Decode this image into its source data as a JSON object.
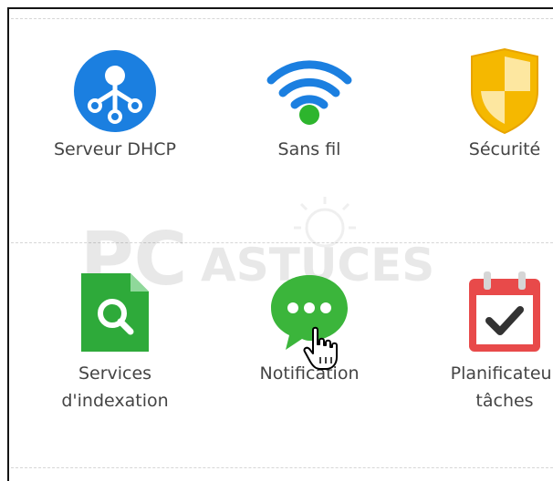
{
  "tiles": [
    {
      "label": "Serveur DHCP",
      "icon": "dhcp-server-icon",
      "color": "#1b7fe0"
    },
    {
      "label": "Sans fil",
      "icon": "wifi-icon",
      "color": "#1b7fe0",
      "dot_color": "#2db52d"
    },
    {
      "label": "Sécurité",
      "icon": "security-shield-icon",
      "color": "#f5b800"
    },
    {
      "label_line1": "Services",
      "label_line2": "d'indexation",
      "icon": "search-index-icon",
      "color": "#2eaa3a"
    },
    {
      "label": "Notification",
      "icon": "notification-chat-icon",
      "color": "#3bb53b"
    },
    {
      "label_line1": "Planificateur",
      "label_line2": "tâches",
      "icon": "calendar-check-icon",
      "color": "#e84a4a"
    }
  ],
  "watermark": {
    "text_pc": "PC",
    "text_astuces": "ASTUCES"
  },
  "cursor": {
    "icon": "hand-pointer-cursor-icon"
  }
}
